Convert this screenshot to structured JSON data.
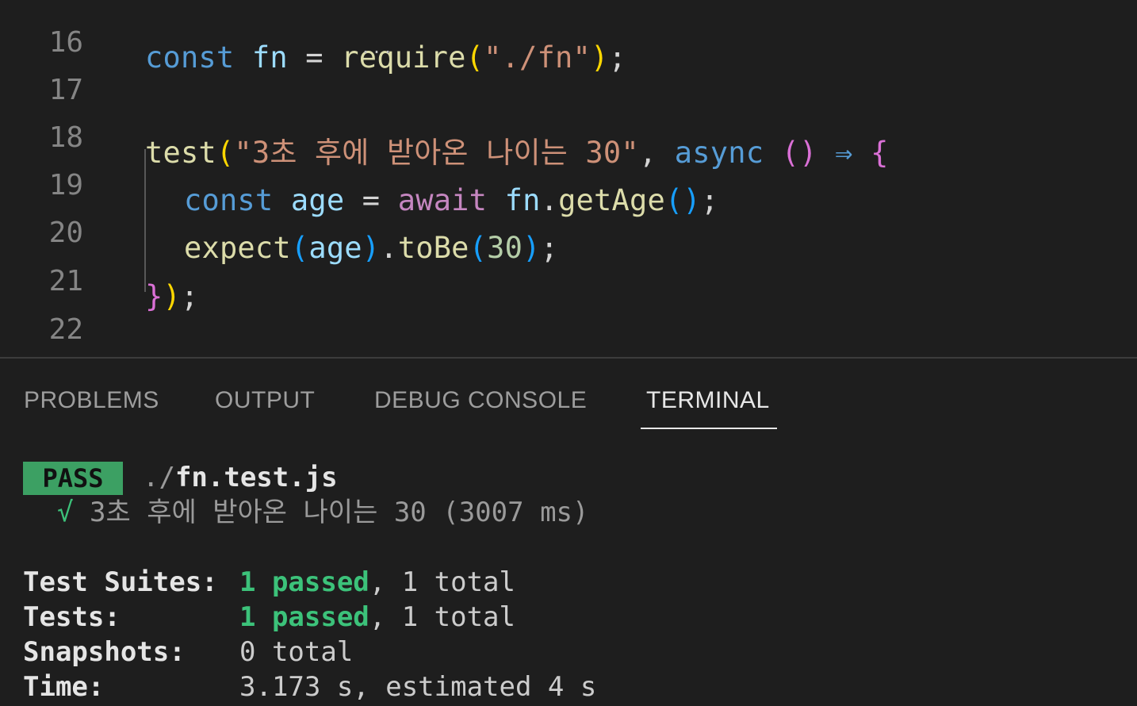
{
  "editor": {
    "lines": [
      {
        "num": "16"
      },
      {
        "num": "17"
      },
      {
        "num": "18"
      },
      {
        "num": "19"
      },
      {
        "num": "20"
      },
      {
        "num": "21"
      },
      {
        "num": "22"
      }
    ],
    "l16": {
      "kw": "const",
      "name": "fn",
      "eq": " = ",
      "fn": "require",
      "op": "(",
      "str": "\"./fn\"",
      "cp": ")",
      "semi": ";"
    },
    "l18": {
      "fn": "test",
      "op": "(",
      "str": "\"3초 후에 받아온 나이는 30\"",
      "comma": ", ",
      "kw": "async",
      "sp": " ",
      "args": "()",
      "arrow": " ⇒ ",
      "brace": "{"
    },
    "l19": {
      "kw": "const",
      "name": "age",
      "eq": " = ",
      "await": "await",
      "obj": "fn",
      "dot": ".",
      "method": "getAge",
      "parens": "()",
      "semi": ";"
    },
    "l20": {
      "fn": "expect",
      "op": "(",
      "arg": "age",
      "cp": ")",
      "dot": ".",
      "method": "toBe",
      "op2": "(",
      "num": "30",
      "cp2": ")",
      "semi": ";"
    },
    "l21": {
      "brace": "}",
      "cp": ")",
      "semi": ";"
    },
    "hint_dots": "..."
  },
  "panel": {
    "tabs": [
      "PROBLEMS",
      "OUTPUT",
      "DEBUG CONSOLE",
      "TERMINAL"
    ],
    "active_tab": "TERMINAL"
  },
  "terminal": {
    "badge": "PASS",
    "path_prefix": "./",
    "file": "fn.test.js",
    "check": "√",
    "test_name": "3초 후에 받아온 나이는 30 (3007 ms)",
    "summary": [
      {
        "label": "Test Suites:",
        "passed": "1 passed",
        "rest": ", 1 total"
      },
      {
        "label": "Tests:",
        "passed": "1 passed",
        "rest": ", 1 total"
      },
      {
        "label": "Snapshots:",
        "passed": "",
        "rest": "0 total"
      },
      {
        "label": "Time:",
        "passed": "",
        "rest": "3.173 s, estimated 4 s"
      }
    ]
  },
  "colors": {
    "background": "#1e1e1e",
    "keyword": "#569cd6",
    "string": "#ce9178",
    "function": "#dcdcaa",
    "pass_badge": "#3ca063",
    "passed_text": "#3cc27a"
  }
}
